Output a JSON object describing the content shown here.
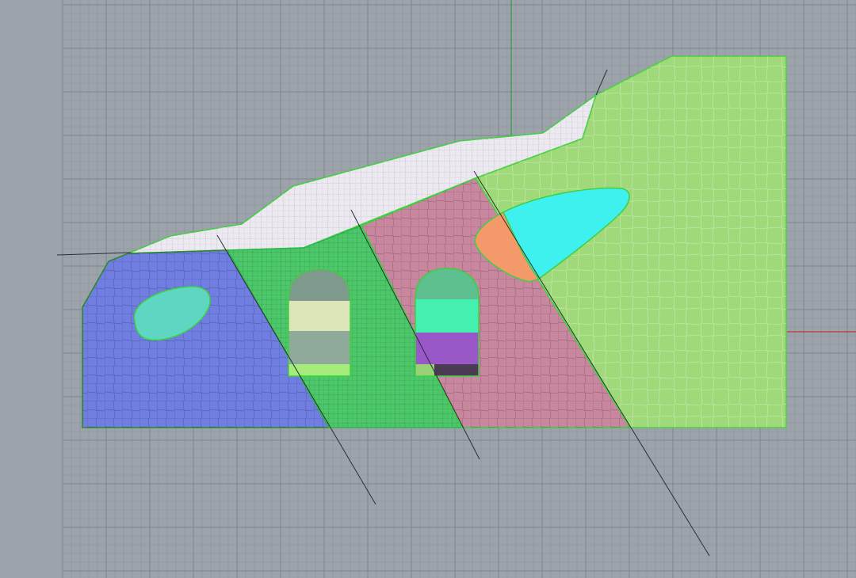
{
  "viewport": {
    "name": "Top",
    "background": "#9da3aa",
    "grid_minor_color": "#8c939b",
    "grid_major_color": "#7d848c",
    "x_axis_color": "#c0392b",
    "y_axis_color": "#2e9d3a"
  },
  "regions": [
    {
      "id": "soil-overburden",
      "fill": "#ece9f0",
      "edge": "#3fcf3f",
      "mesh": "#d2cfd8"
    },
    {
      "id": "zone-blue",
      "fill": "#6f7ee0",
      "edge": "#2c8a2c",
      "mesh": "#3b3fd4"
    },
    {
      "id": "zone-green",
      "fill": "#4cc86a",
      "edge": "#2eb84a",
      "mesh": "#25a43c"
    },
    {
      "id": "zone-pink",
      "fill": "#c9879f",
      "edge": "#3fcf3f",
      "mesh": "#b04d7e"
    },
    {
      "id": "zone-light-green",
      "fill": "#9fd97a",
      "edge": "#4ad044",
      "mesh": "#7cce3e"
    }
  ],
  "inclusions": [
    {
      "id": "inclusion-left",
      "fill": "#5fd6c2",
      "edge": "#3fcf3f"
    },
    {
      "id": "inclusion-right",
      "fill": "#3ef0ee",
      "overlap_fill": "#f49a6a",
      "edge": "#3fcf3f"
    }
  ],
  "tunnels": [
    {
      "id": "tunnel-left",
      "crown": "#7d9a8c",
      "band_top": "#dde6b8",
      "band_mid": "#8fa99a",
      "invert": "#a6ec7c"
    },
    {
      "id": "tunnel-right",
      "crown": "#5ec08e",
      "band_top": "#44efb0",
      "band_mid": "#9a57c8",
      "invert": "#4b3a53"
    }
  ]
}
